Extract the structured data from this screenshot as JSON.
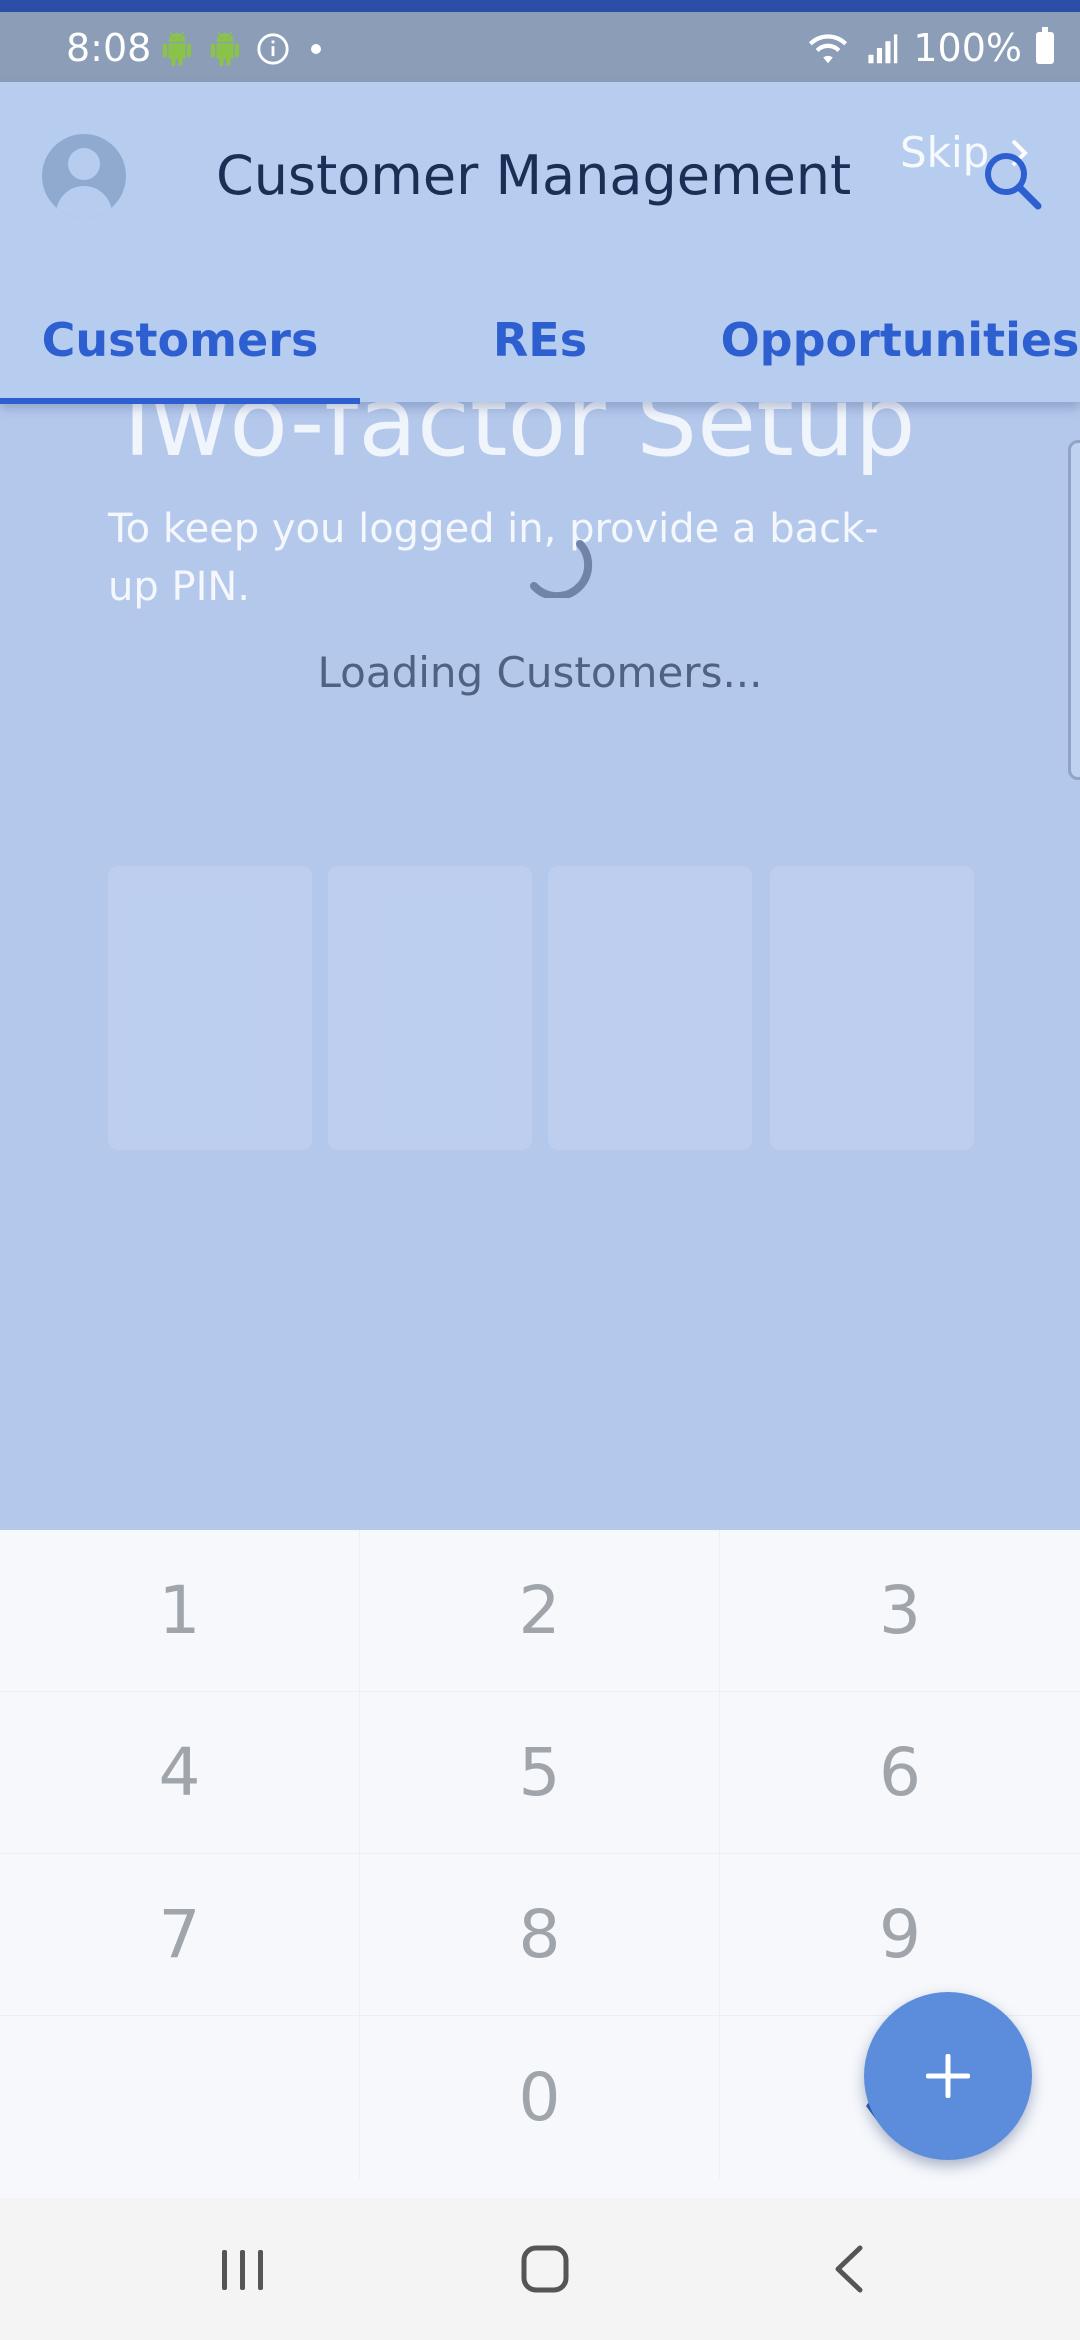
{
  "status_bar": {
    "time": "8:08",
    "battery": "100%",
    "icons": [
      "android-icon",
      "android-icon",
      "info-icon",
      "dot-icon",
      "wifi-icon",
      "signal-icon",
      "battery-icon"
    ]
  },
  "header": {
    "title": "Customer Management",
    "skip_label": "Skip",
    "tabs": [
      {
        "label": "Customers",
        "selected": true
      },
      {
        "label": "REs",
        "selected": false
      },
      {
        "label": "Opportunities",
        "selected": false
      }
    ]
  },
  "background_screen": {
    "title": "Two-factor Setup",
    "subtitle": "To keep you logged in, provide a back-up PIN."
  },
  "loading": {
    "text": "Loading Customers..."
  },
  "keypad": {
    "keys": [
      "1",
      "2",
      "3",
      "4",
      "5",
      "6",
      "7",
      "8",
      "9",
      "",
      "0",
      ""
    ]
  },
  "colors": {
    "accent": "#2d5fd0",
    "header_bg": "#b7cdef",
    "fab": "#5b8ddc",
    "status_bar": "#8b9db7"
  }
}
